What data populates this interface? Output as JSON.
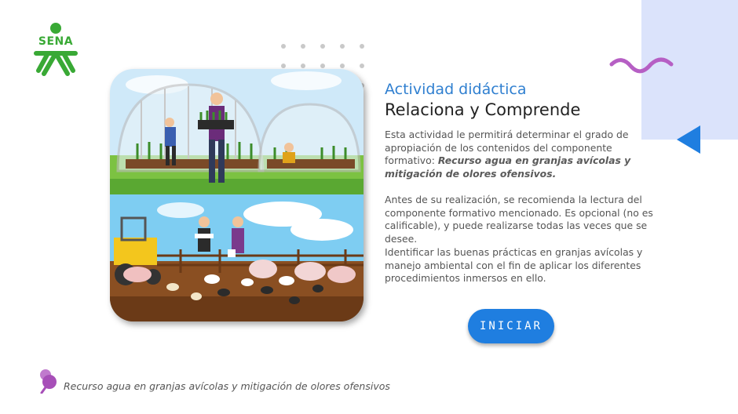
{
  "brand": {
    "logo_text": "SENA",
    "color": "#39a935"
  },
  "content": {
    "subtitle": "Actividad didáctica",
    "title": "Relaciona y Comprende",
    "paragraph1_text": "Esta actividad le permitirá determinar el grado de apropiación de los contenidos del componente formativo: ",
    "paragraph1_emphasis": "Recurso agua en granjas avícolas y mitigación de olores ofensivos.",
    "paragraph2": "Antes de su realización, se recomienda la lectura del componente formativo mencionado.  Es opcional (no es calificable), y puede realizarse todas las veces que se desee.",
    "paragraph3": "Identificar las buenas prácticas en granjas avícolas y manejo ambiental con el fin de aplicar los diferentes procedimientos inmersos en ello."
  },
  "start_button": {
    "label": "INICIAR"
  },
  "footer": {
    "course_title": "Recurso agua en granjas avícolas y mitigación de olores ofensivos"
  },
  "colors": {
    "accent_blue": "#2f7fd0",
    "button_blue": "#1f7ee0",
    "panel": "#dbe3fb",
    "decor_purple": "#b65fc4"
  },
  "icons": [
    "sena-logo",
    "dots-decor-icon",
    "squiggle-decor-icon",
    "triangle-arrow-icon",
    "pin-icon"
  ]
}
